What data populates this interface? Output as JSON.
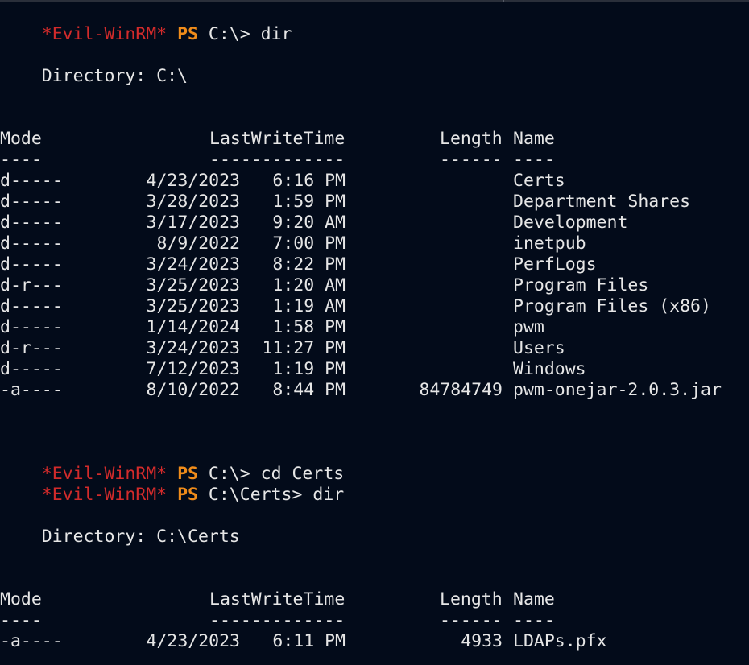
{
  "prompt": {
    "label": "*Evil-WinRM*",
    "shell": "PS"
  },
  "colors": {
    "background": "#030b1a",
    "text": "#e6e6e6",
    "prompt_label": "#d32b2b",
    "prompt_ps": "#f08c1a"
  },
  "commands": [
    {
      "path": "C:\\>",
      "cmd": "dir"
    },
    {
      "path": "C:\\>",
      "cmd": "cd Certs"
    },
    {
      "path": "C:\\Certs>",
      "cmd": "dir"
    }
  ],
  "listings": [
    {
      "directory": "    Directory: C:\\",
      "headers": {
        "mode": "Mode",
        "time": "LastWriteTime",
        "length": "Length",
        "name": "Name"
      },
      "separators": {
        "mode": "----",
        "time": "-------------",
        "length": "------",
        "name": "----"
      },
      "rows": [
        {
          "mode": "d-----",
          "date": "4/23/2023",
          "time": "6:16 PM",
          "length": "",
          "name": "Certs"
        },
        {
          "mode": "d-----",
          "date": "3/28/2023",
          "time": "1:59 PM",
          "length": "",
          "name": "Department Shares"
        },
        {
          "mode": "d-----",
          "date": "3/17/2023",
          "time": "9:20 AM",
          "length": "",
          "name": "Development"
        },
        {
          "mode": "d-----",
          "date": "8/9/2022",
          "time": "7:00 PM",
          "length": "",
          "name": "inetpub"
        },
        {
          "mode": "d-----",
          "date": "3/24/2023",
          "time": "8:22 PM",
          "length": "",
          "name": "PerfLogs"
        },
        {
          "mode": "d-r---",
          "date": "3/25/2023",
          "time": "1:20 AM",
          "length": "",
          "name": "Program Files"
        },
        {
          "mode": "d-----",
          "date": "3/25/2023",
          "time": "1:19 AM",
          "length": "",
          "name": "Program Files (x86)"
        },
        {
          "mode": "d-----",
          "date": "1/14/2024",
          "time": "1:58 PM",
          "length": "",
          "name": "pwm"
        },
        {
          "mode": "d-r---",
          "date": "3/24/2023",
          "time": "11:27 PM",
          "length": "",
          "name": "Users"
        },
        {
          "mode": "d-----",
          "date": "7/12/2023",
          "time": "1:19 PM",
          "length": "",
          "name": "Windows"
        },
        {
          "mode": "-a----",
          "date": "8/10/2022",
          "time": "8:44 PM",
          "length": "84784749",
          "name": "pwm-onejar-2.0.3.jar"
        }
      ]
    },
    {
      "directory": "    Directory: C:\\Certs",
      "headers": {
        "mode": "Mode",
        "time": "LastWriteTime",
        "length": "Length",
        "name": "Name"
      },
      "separators": {
        "mode": "----",
        "time": "-------------",
        "length": "------",
        "name": "----"
      },
      "rows": [
        {
          "mode": "-a----",
          "date": "4/23/2023",
          "time": "6:11 PM",
          "length": "4933",
          "name": "LDAPs.pfx"
        }
      ]
    }
  ]
}
